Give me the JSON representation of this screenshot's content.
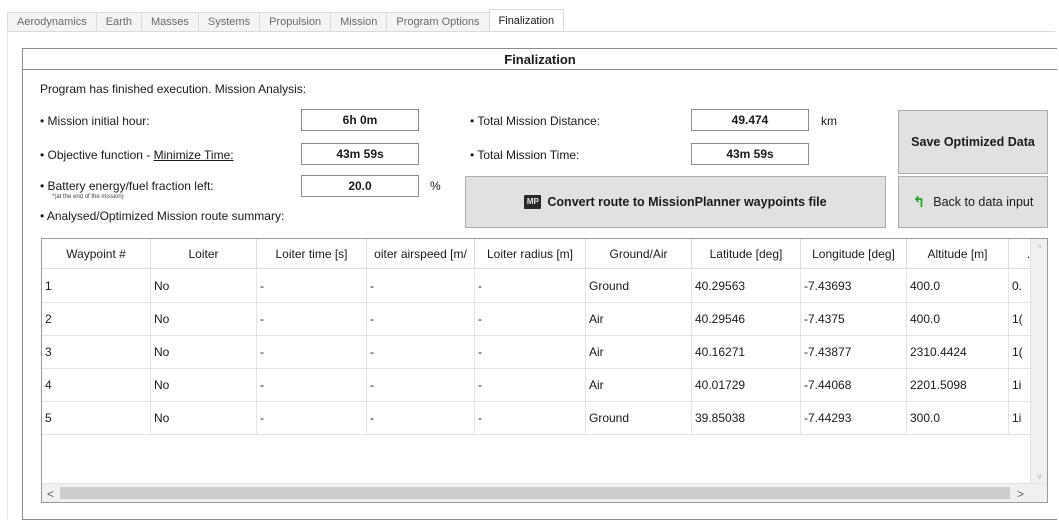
{
  "tabs": [
    "Aerodynamics",
    "Earth",
    "Masses",
    "Systems",
    "Propulsion",
    "Mission",
    "Program Options",
    "Finalization"
  ],
  "active_tab": "Finalization",
  "group_title": "Finalization",
  "status_text": "Program has finished execution. Mission Analysis:",
  "fields": {
    "initial_hour": {
      "label": "• Mission initial hour:",
      "value": "6h 0m"
    },
    "objective": {
      "label_prefix": "• Objective function - ",
      "label_link": "Minimize Time:",
      "value": "43m 59s"
    },
    "battery": {
      "label": "• Battery energy/fuel fraction left:",
      "note": "*(at the end of the mission)",
      "value": "20.0",
      "unit": "%"
    },
    "total_distance": {
      "label": "• Total Mission Distance:",
      "value": "49.474",
      "unit": "km"
    },
    "total_time": {
      "label": "• Total Mission Time:",
      "value": "43m 59s"
    }
  },
  "summary_label": "• Analysed/Optimized Mission route summary:",
  "buttons": {
    "save": "Save Optimized Data",
    "convert": "Convert route to MissionPlanner waypoints file",
    "convert_icon_text": "MP",
    "back": "Back to data input"
  },
  "table": {
    "columns": [
      "Waypoint #",
      "Loiter",
      "Loiter time [s]",
      "oiter airspeed [m/",
      "Loiter radius [m]",
      "Ground/Air",
      "Latitude [deg]",
      "Longitude [deg]",
      "Altitude [m]",
      "."
    ],
    "rows": [
      [
        "1",
        "No",
        "-",
        "-",
        "-",
        "Ground",
        "40.29563",
        "-7.43693",
        "400.0",
        "0."
      ],
      [
        "2",
        "No",
        "-",
        "-",
        "-",
        "Air",
        "40.29546",
        "-7.4375",
        "400.0",
        "1("
      ],
      [
        "3",
        "No",
        "-",
        "-",
        "-",
        "Air",
        "40.16271",
        "-7.43877",
        "2310.4424",
        "1("
      ],
      [
        "4",
        "No",
        "-",
        "-",
        "-",
        "Air",
        "40.01729",
        "-7.44068",
        "2201.5098",
        "1i"
      ],
      [
        "5",
        "No",
        "-",
        "-",
        "-",
        "Ground",
        "39.85038",
        "-7.44293",
        "300.0",
        "1i"
      ]
    ]
  },
  "scroll": {
    "up": "^",
    "down": "v",
    "left": "<",
    "right": ">"
  }
}
